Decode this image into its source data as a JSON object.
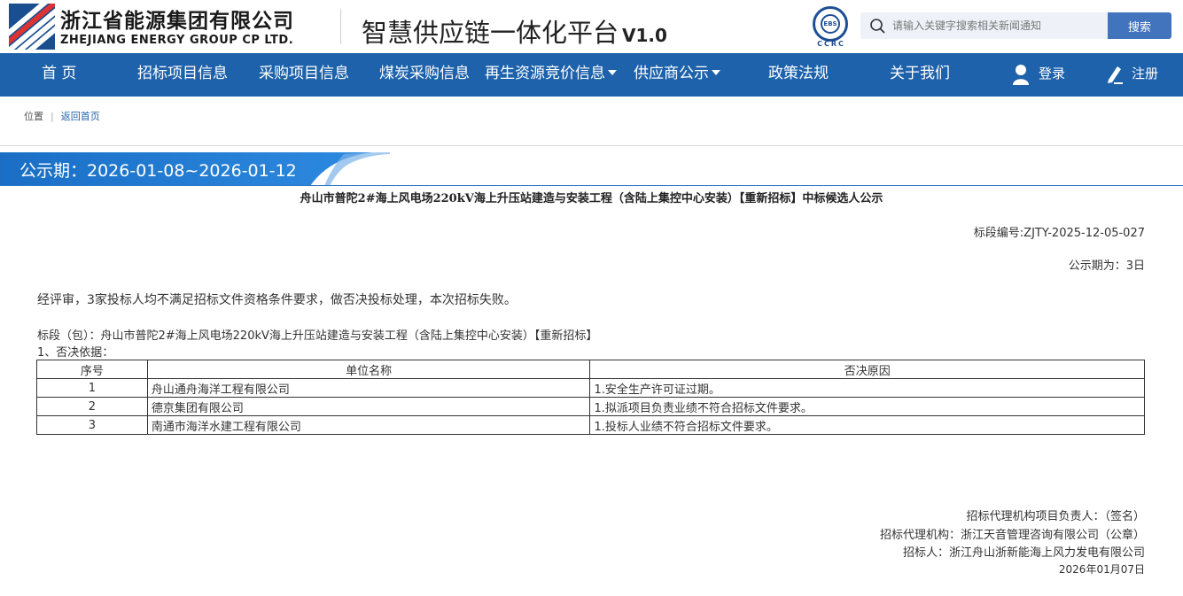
{
  "header": {
    "company_cn": "浙江省能源集团有限公司",
    "company_en": "ZHEJIANG ENERGY GROUP CP LTD.",
    "platform_title": "智慧供应链一体化平台",
    "platform_version": "V1.0",
    "ebs_badge": "EBS",
    "ccrc_label": "CCRC",
    "search_placeholder": "请输入关键字搜索相关新闻通知",
    "search_button": "搜索"
  },
  "nav": {
    "items": [
      {
        "label": "首 页"
      },
      {
        "label": "招标项目信息"
      },
      {
        "label": "采购项目信息"
      },
      {
        "label": "煤炭采购信息"
      },
      {
        "label": "再生资源竞价信息"
      },
      {
        "label": "供应商公示"
      },
      {
        "label": "政策法规"
      },
      {
        "label": "关于我们"
      }
    ],
    "login": "登录",
    "register": "注册"
  },
  "breadcrumb": {
    "location": "位置",
    "separator": "|",
    "home_link": "返回首页"
  },
  "notice": {
    "period": "公示期：2026-01-08~2026-01-12",
    "title": "舟山市普陀2#海上风电场220kV海上升压站建造与安装工程（含陆上集控中心安装）【重新招标】中标候选人公示",
    "section_code": "标段编号:ZJTY-2025-12-05-027",
    "period_length": "公示期为：3日",
    "summary": "经评审，3家投标人均不满足招标文件资格条件要求，做否决投标处理，本次招标失败。",
    "lot": "标段（包）：舟山市普陀2#海上风电场220kV海上升压站建造与安装工程（含陆上集控中心安装）【重新招标】",
    "basis_heading": "1、否决依据：",
    "table": {
      "headers": [
        "序号",
        "单位名称",
        "否决原因"
      ],
      "rows": [
        [
          "1",
          "舟山通舟海洋工程有限公司",
          "1.安全生产许可证过期。"
        ],
        [
          "2",
          "德京集团有限公司",
          "1.拟派项目负责业绩不符合招标文件要求。"
        ],
        [
          "3",
          "南通市海洋水建工程有限公司",
          "1.投标人业绩不符合招标文件要求。"
        ]
      ]
    },
    "sign_agent_person": "招标代理机构项目负责人：（签名）",
    "sign_agent": "招标代理机构：浙江天音管理咨询有限公司（公章）",
    "sign_tenderer": "招标人：浙江舟山浙新能海上风力发电有限公司",
    "sign_date": "2026年01月07日"
  },
  "colors": {
    "nav_bg": "#1e62ab",
    "search_button_bg": "#4273bd",
    "banner_blue": "#1a6fc5"
  }
}
